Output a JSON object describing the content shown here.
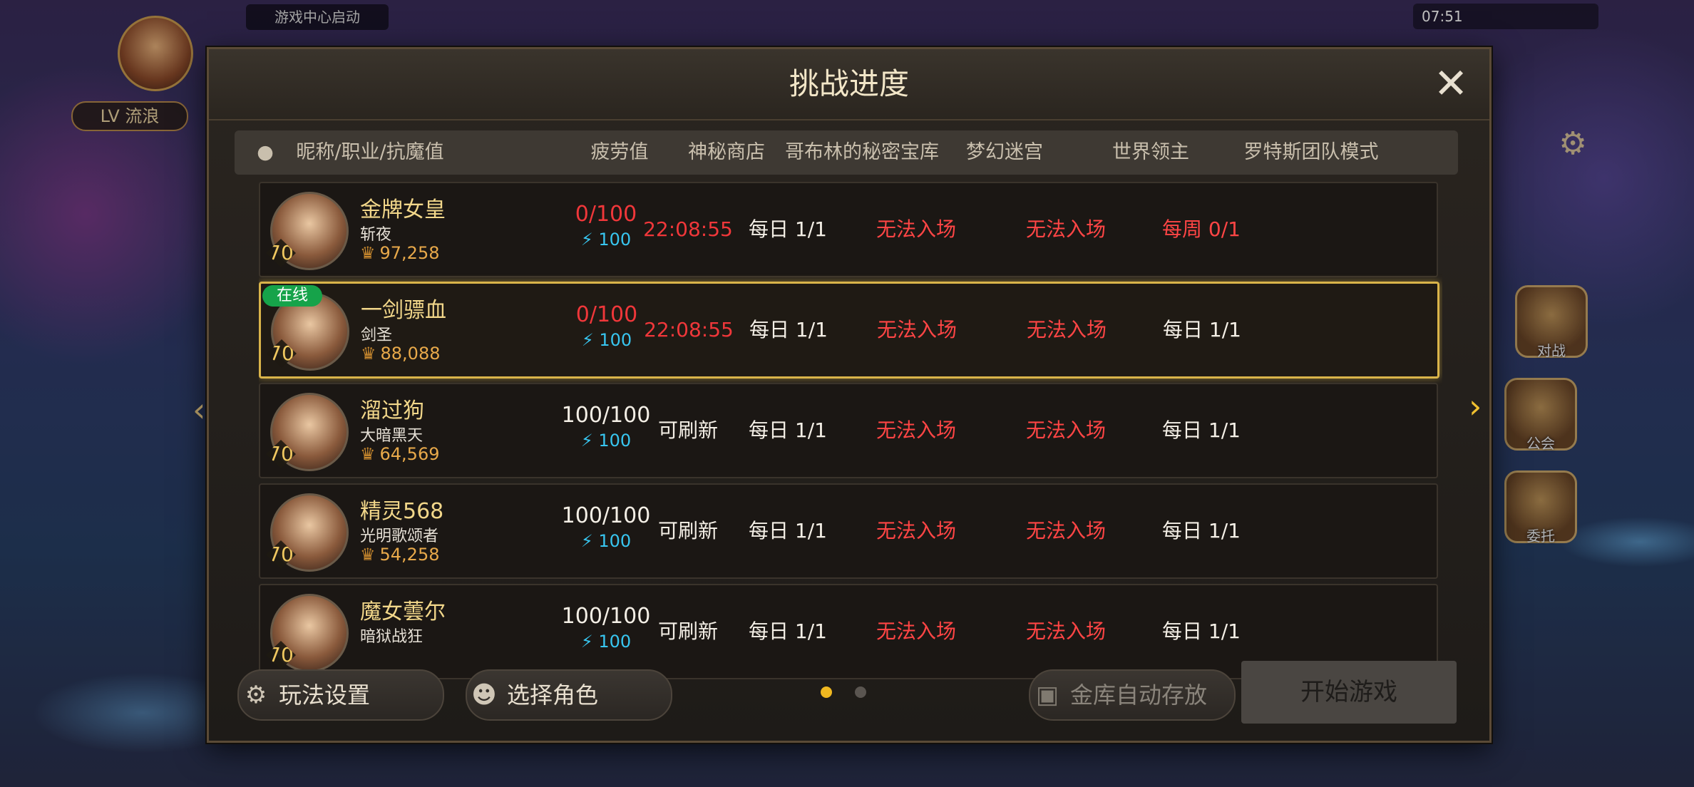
{
  "background": {
    "top_level_label": "LV 流浪",
    "system_chip": "游戏中心启动",
    "status_time": "07:51",
    "side_buttons": [
      "对战",
      "公会",
      "委托"
    ]
  },
  "modal": {
    "title": "挑战进度",
    "close_icon": "close-icon",
    "columns": {
      "name": "昵称/职业/抗魔值",
      "fatigue": "疲劳值",
      "shop": "神秘商店",
      "goblin": "哥布林的秘密宝库",
      "maze": "梦幻迷宫",
      "boss": "世界领主",
      "rotus": "罗特斯团队模式"
    },
    "rows": [
      {
        "name": "金牌女皇",
        "job": "斩夜",
        "power": "97,258",
        "level": "70",
        "online": "",
        "fatigue": "0/100",
        "energy": "100",
        "shop": "22:08:55",
        "goblin": "每日 1/1",
        "maze": "无法入场",
        "boss": "无法入场",
        "rotus": "每周 0/1"
      },
      {
        "name": "一剑骠血",
        "job": "剑圣",
        "power": "88,088",
        "level": "70",
        "online": "在线",
        "fatigue": "0/100",
        "energy": "100",
        "shop": "22:08:55",
        "goblin": "每日 1/1",
        "maze": "无法入场",
        "boss": "无法入场",
        "rotus": "每日 1/1"
      },
      {
        "name": "溜过狗",
        "job": "大暗黑天",
        "power": "64,569",
        "level": "70",
        "online": "",
        "fatigue": "100/100",
        "energy": "100",
        "shop": "可刷新",
        "goblin": "每日 1/1",
        "maze": "无法入场",
        "boss": "无法入场",
        "rotus": "每日 1/1"
      },
      {
        "name": "精灵568",
        "job": "光明歌颂者",
        "power": "54,258",
        "level": "70",
        "online": "",
        "fatigue": "100/100",
        "energy": "100",
        "shop": "可刷新",
        "goblin": "每日 1/1",
        "maze": "无法入场",
        "boss": "无法入场",
        "rotus": "每日 1/1"
      },
      {
        "name": "魔女蕓尔",
        "job": "暗狱战狂",
        "power": "",
        "level": "70",
        "online": "",
        "fatigue": "100/100",
        "energy": "100",
        "shop": "可刷新",
        "goblin": "每日 1/1",
        "maze": "无法入场",
        "boss": "无法入场",
        "rotus": "每日 1/1"
      }
    ],
    "footer": {
      "settings_label": "玩法设置",
      "select_role_label": "选择角色",
      "auto_store_label": "金库自动存放",
      "start_label": "开始游戏"
    },
    "colors": {
      "accent": "#d9b44a",
      "red": "#f0373a",
      "energy": "#38c6f0",
      "page_dot_active": "#f0b820",
      "page_dot_inactive": "#5a5550"
    }
  }
}
